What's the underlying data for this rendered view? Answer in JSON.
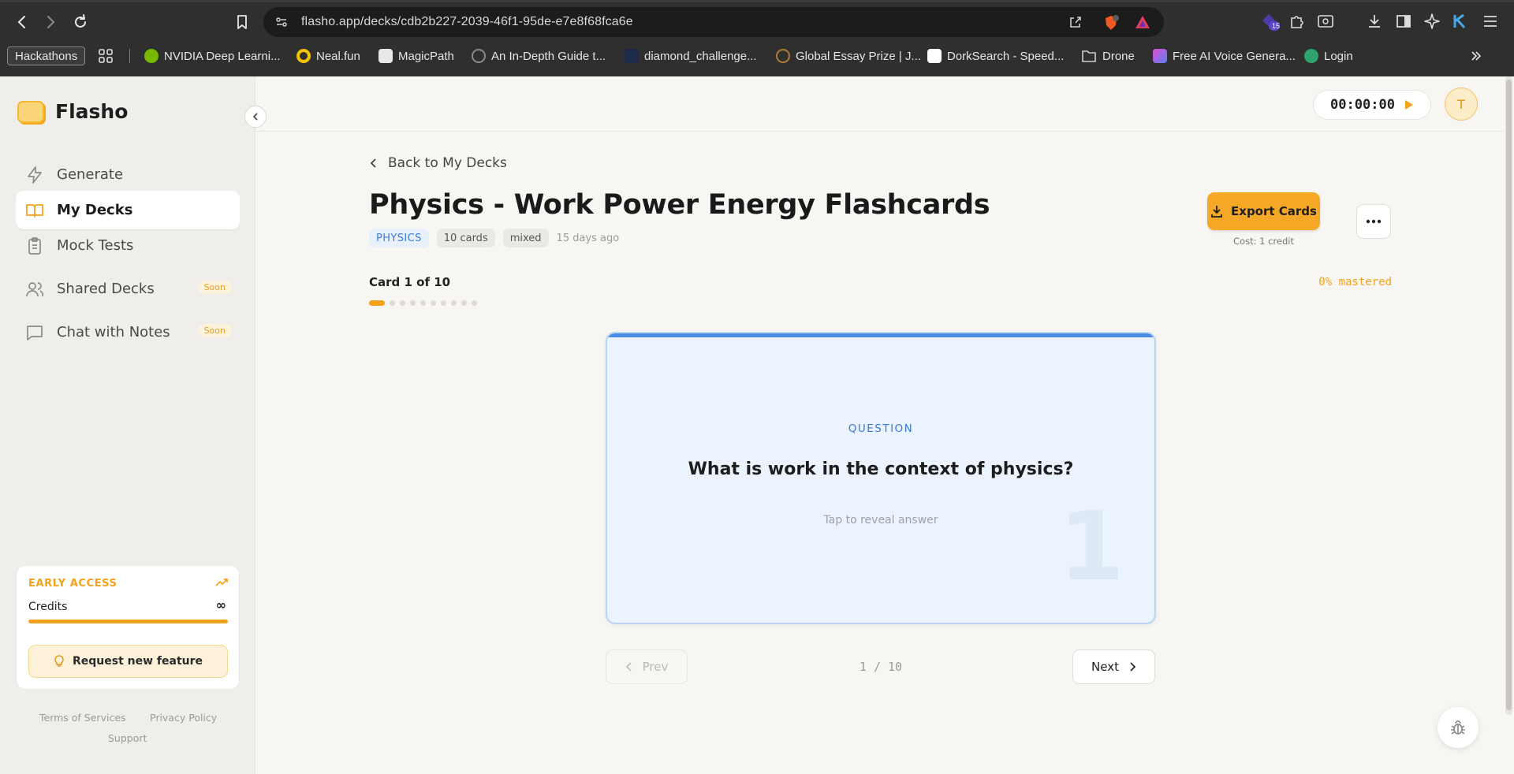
{
  "browser": {
    "url": "flasho.app/decks/cdb2b227-2039-46f1-95de-e7e8f68fca6e",
    "extension_badge": "15",
    "bookmarks": [
      {
        "label": "Hackathons",
        "color": "#3c3c3c"
      },
      {
        "label": "NVIDIA Deep Learni...",
        "color": "#76b900"
      },
      {
        "label": "Neal.fun",
        "color": "#ffd400"
      },
      {
        "label": "MagicPath",
        "color": "#e8e8e8"
      },
      {
        "label": "An In-Depth Guide t...",
        "color": "#8a8a8a"
      },
      {
        "label": "diamond_challenge...",
        "color": "#2d4a8a"
      },
      {
        "label": "Global Essay Prize | J...",
        "color": "#b07a3a"
      },
      {
        "label": "DorkSearch - Speed...",
        "color": "#ffffff"
      },
      {
        "label": "Drone",
        "color": "#cfcfcf"
      },
      {
        "label": "Free AI Voice Genera...",
        "color": "#b94fd4"
      },
      {
        "label": "Login",
        "color": "#2fa36b"
      }
    ]
  },
  "sidebar": {
    "brand": "Flasho",
    "items": [
      {
        "label": "Generate",
        "icon": "bolt-icon",
        "active": false,
        "soon": ""
      },
      {
        "label": "My Decks",
        "icon": "book-icon",
        "active": true,
        "soon": ""
      },
      {
        "label": "Mock Tests",
        "icon": "clipboard-icon",
        "active": false,
        "soon": ""
      },
      {
        "label": "Shared Decks",
        "icon": "users-icon",
        "active": false,
        "soon": "Soon"
      },
      {
        "label": "Chat with Notes",
        "icon": "chat-icon",
        "active": false,
        "soon": "Soon"
      }
    ],
    "early_access": {
      "title": "EARLY ACCESS",
      "credits_label": "Credits",
      "credits_value": "∞",
      "credits_fill": 1.0,
      "request_label": "Request new feature"
    },
    "footer": {
      "terms": "Terms of Services",
      "privacy": "Privacy Policy",
      "support": "Support"
    }
  },
  "header": {
    "timer": "00:00:00",
    "avatar_initial": "T"
  },
  "deck": {
    "back_label": "Back to My Decks",
    "title": "Physics - Work Power Energy Flashcards",
    "subject": "PHYSICS",
    "card_count": "10 cards",
    "mode": "mixed",
    "age": "15 days ago",
    "export_label": "Export Cards",
    "export_cost": "Cost: 1 credit",
    "progress_label": "Card 1 of 10",
    "mastered_label": "0% mastered",
    "total_cards": 10,
    "current_card": 1
  },
  "card": {
    "label": "QUESTION",
    "question": "What is work in the context of physics?",
    "hint": "Tap to reveal answer",
    "number": "1"
  },
  "pager": {
    "prev_label": "Prev",
    "next_label": "Next",
    "position": "1 / 10"
  },
  "colors": {
    "accent": "#f2a21b",
    "card_blue": "#4a8be3",
    "card_bg": "#eaf3fe"
  }
}
